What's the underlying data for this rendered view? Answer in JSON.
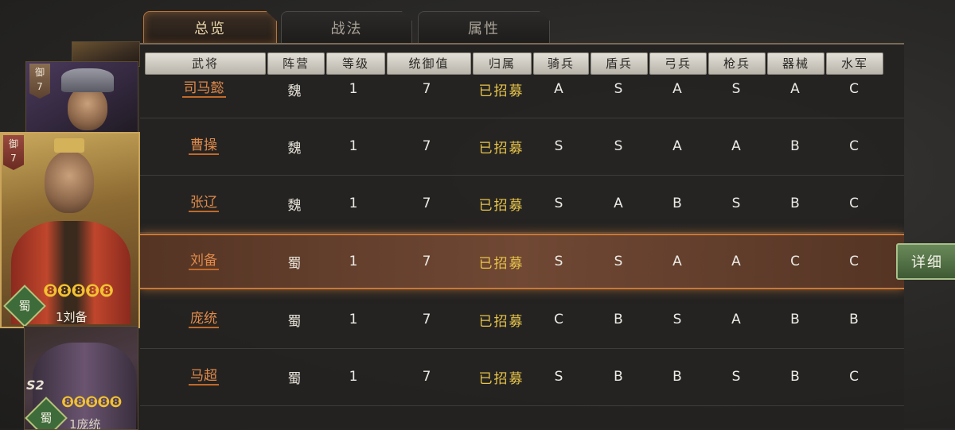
{
  "tabs": [
    {
      "label": "总览",
      "active": true
    },
    {
      "label": "战法",
      "active": false
    },
    {
      "label": "属性",
      "active": false
    }
  ],
  "columns": [
    "武将",
    "阵营",
    "等级",
    "统御值",
    "归属",
    "骑兵",
    "盾兵",
    "弓兵",
    "枪兵",
    "器械",
    "水军"
  ],
  "rows": [
    {
      "name": "司马懿",
      "faction": "魏",
      "level": "1",
      "command": "7",
      "status": "已招募",
      "cavalry": "A",
      "shield": "S",
      "bow": "A",
      "spear": "S",
      "siege": "A",
      "navy": "C"
    },
    {
      "name": "曹操",
      "faction": "魏",
      "level": "1",
      "command": "7",
      "status": "已招募",
      "cavalry": "S",
      "shield": "S",
      "bow": "A",
      "spear": "A",
      "siege": "B",
      "navy": "C"
    },
    {
      "name": "张辽",
      "faction": "魏",
      "level": "1",
      "command": "7",
      "status": "已招募",
      "cavalry": "S",
      "shield": "A",
      "bow": "B",
      "spear": "S",
      "siege": "B",
      "navy": "C"
    },
    {
      "name": "刘备",
      "faction": "蜀",
      "level": "1",
      "command": "7",
      "status": "已招募",
      "cavalry": "S",
      "shield": "S",
      "bow": "A",
      "spear": "A",
      "siege": "C",
      "navy": "C"
    },
    {
      "name": "庞统",
      "faction": "蜀",
      "level": "1",
      "command": "7",
      "status": "已招募",
      "cavalry": "C",
      "shield": "B",
      "bow": "S",
      "spear": "A",
      "siege": "B",
      "navy": "B"
    },
    {
      "name": "马超",
      "faction": "蜀",
      "level": "1",
      "command": "7",
      "status": "已招募",
      "cavalry": "S",
      "shield": "B",
      "bow": "B",
      "spear": "S",
      "siege": "B",
      "navy": "C"
    }
  ],
  "detail_button": "详细",
  "cards": {
    "back2": {
      "badge_top": "御",
      "badge_num": "7"
    },
    "main": {
      "badge_top": "御",
      "badge_num": "7",
      "faction": "蜀",
      "stars": "❽❽❽❽❽",
      "label": "1刘备"
    },
    "next": {
      "stars": "❽❽❽❽❽",
      "label": "1庞统",
      "tag": "S2",
      "faction": "蜀"
    }
  },
  "colors": {
    "accent": "#c87838",
    "name": "#e08a4a",
    "status": "#e8c44a",
    "button": "#4e6e44"
  }
}
